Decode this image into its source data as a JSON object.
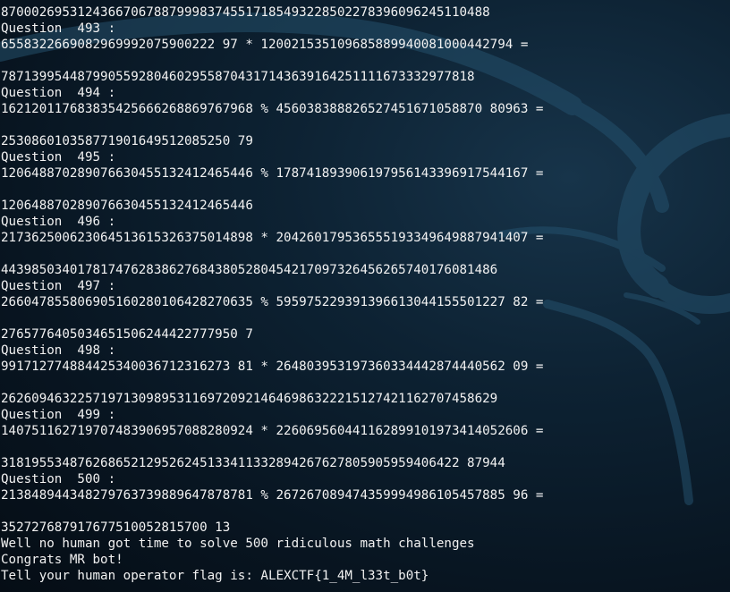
{
  "terminal": {
    "lines": [
      "8700026953124366706788799983745517185493228502278396096245110488",
      "Question  493 :",
      "6558322669082969992075900222 97 * 120021535109685889940081000442794 =",
      "",
      "78713995448799055928046029558704317143639164251111673332977818",
      "Question  494 :",
      "162120117683835425666268869767968 % 456038388826527451671058870 80963 =",
      "",
      "253086010358771901649512085250 79",
      "Question  495 :",
      "120648870289076630455132412465446 % 178741893906197956143396917544167 =",
      "",
      "120648870289076630455132412465446",
      "Question  496 :",
      "217362500623064513615326375014898 * 204260179536555193349649887941407 =",
      "",
      "44398503401781747628386276843805280454217097326456265740176081486",
      "Question  497 :",
      "266047855806905160280106428270635 % 595975229391396613044155501227 82 =",
      "",
      "2765776405034651506244422777950 7",
      "Question  498 :",
      "991712774884425340036712316273 81 * 264803953197360334442874440562 09 =",
      "",
      "26260946322571971309895311697209214646986322215127421162707458629",
      "Question  499 :",
      "140751162719707483906957088280924 * 226069560441162899101973414052606 =",
      "",
      "318195534876268652129526245133411332894267627805905959406422 87944",
      "Question  500 :",
      "213848944348279763739889647878781 % 267267089474359994986105457885 96 =",
      "",
      "352727687917677510052815700 13",
      "Well no human got time to solve 500 ridiculous math challenges",
      "Congrats MR bot!",
      "Tell your human operator flag is: ALEXCTF{1_4M_l33t_b0t}"
    ]
  }
}
